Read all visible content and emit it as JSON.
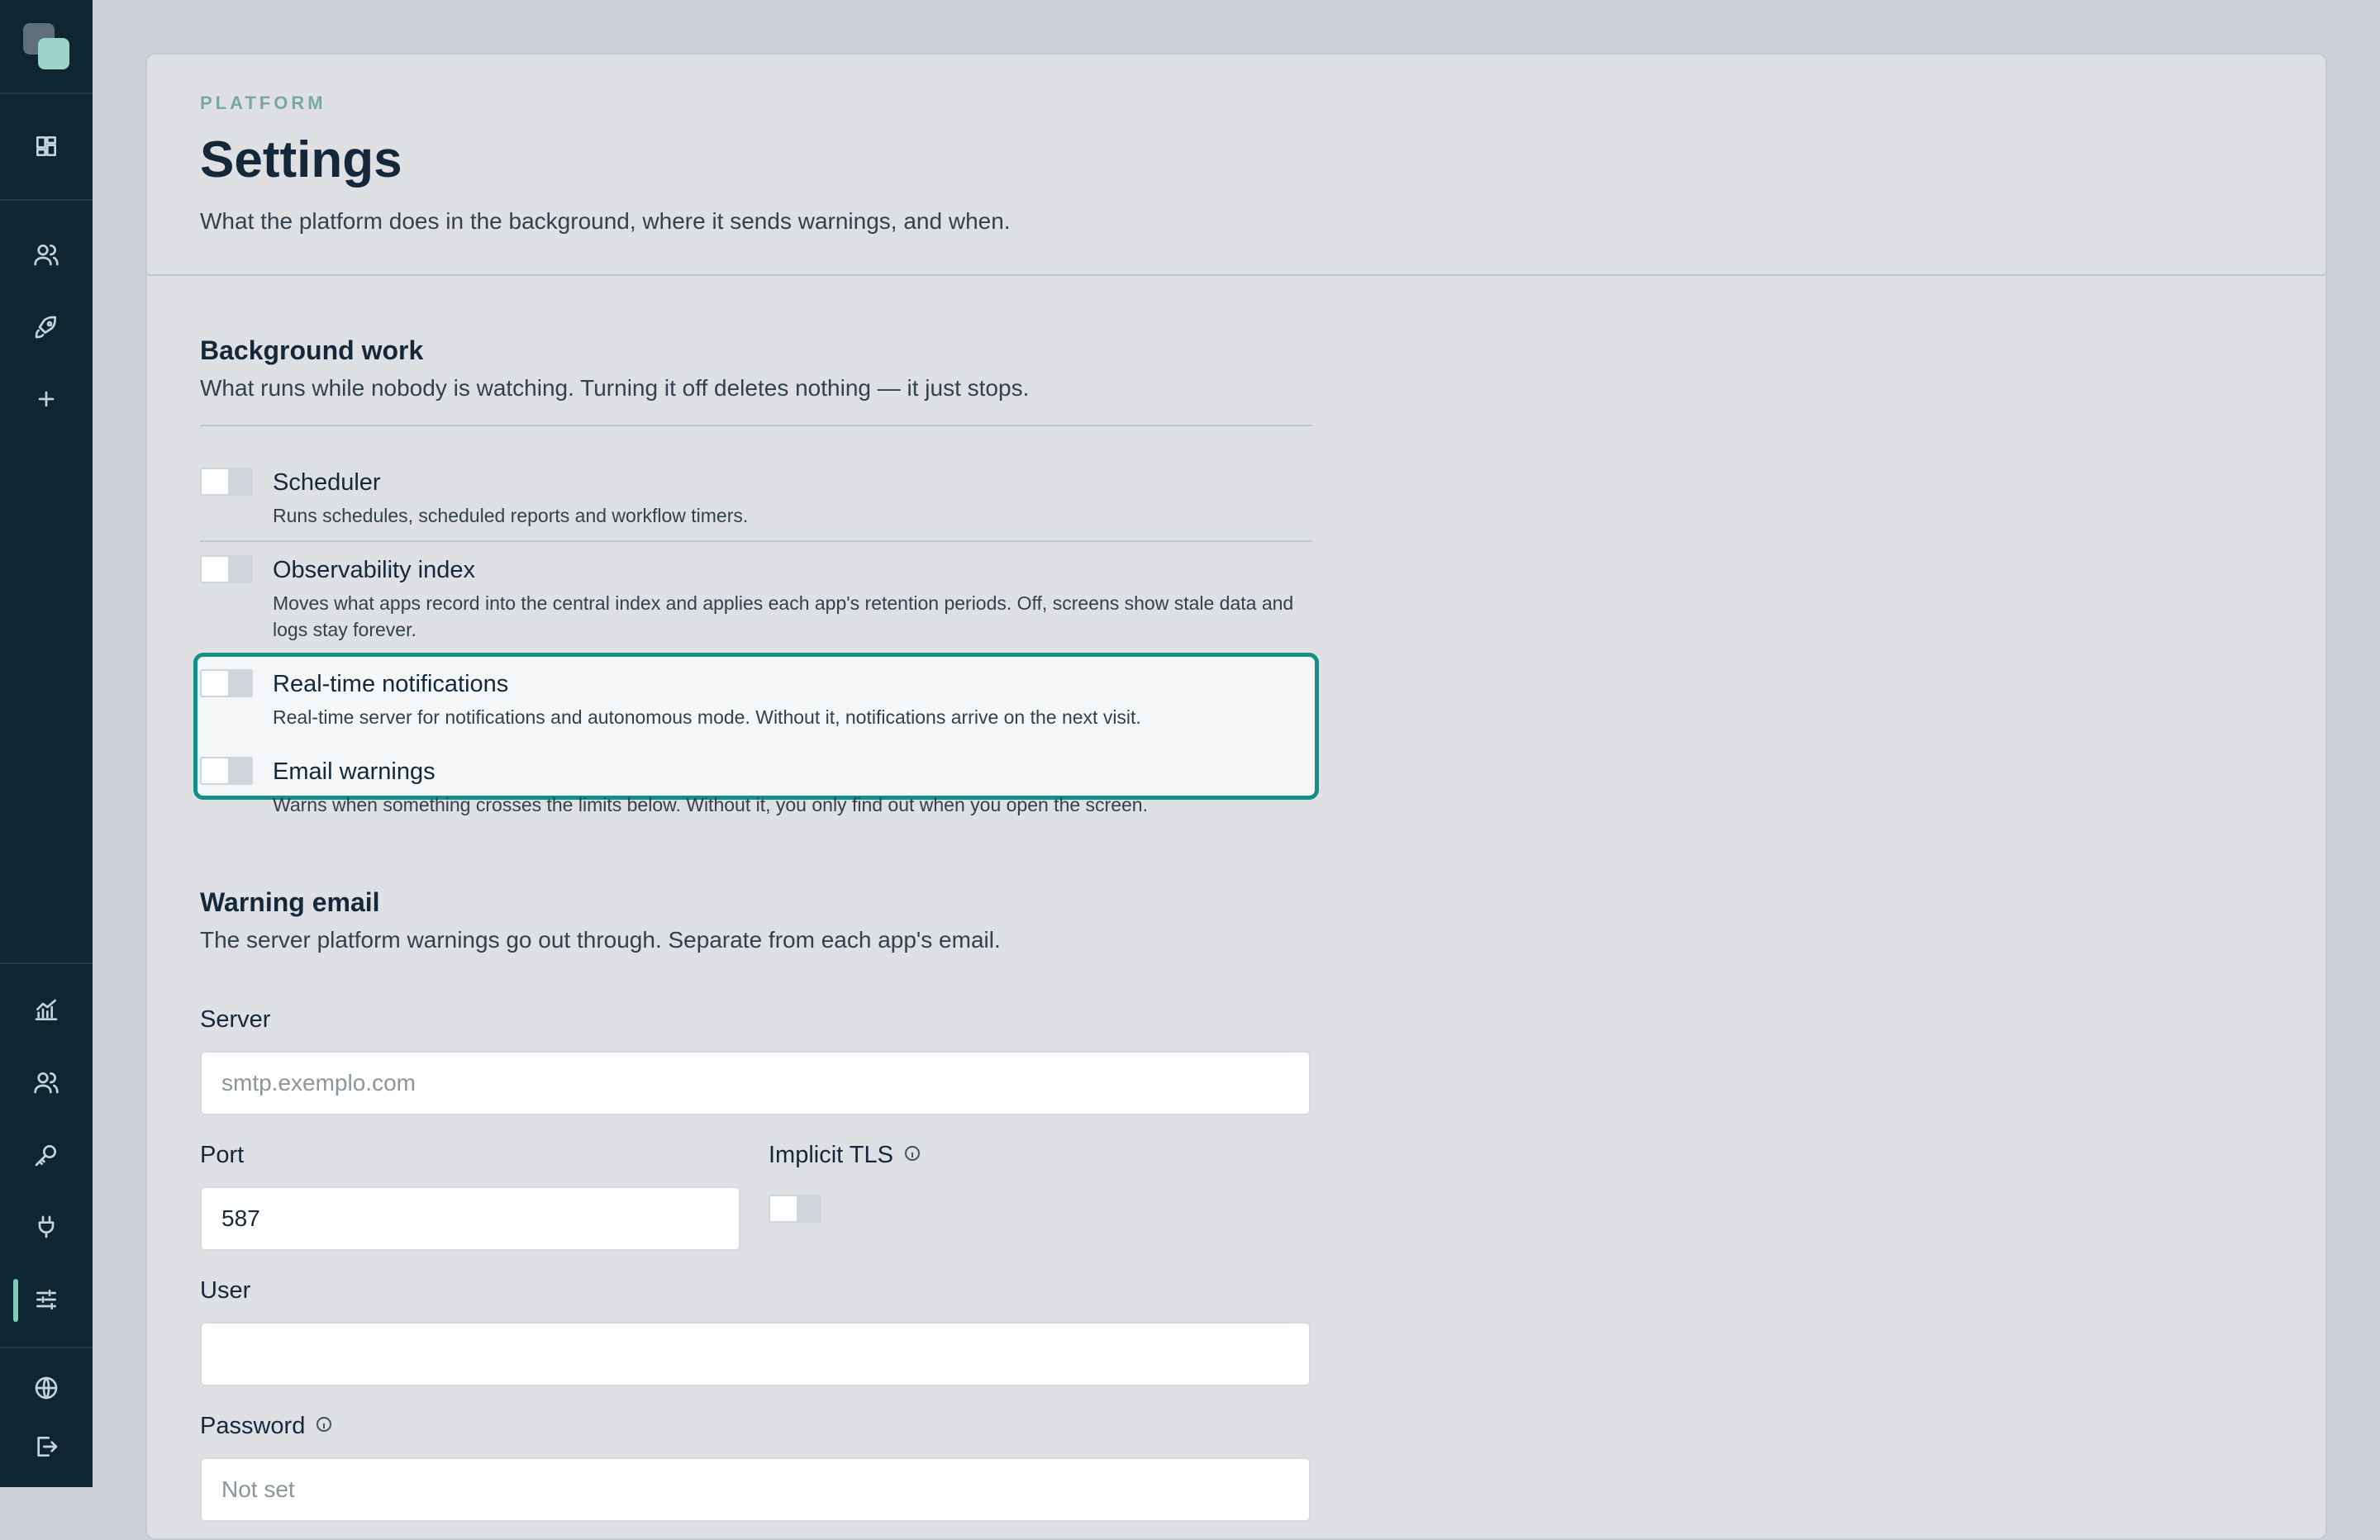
{
  "header": {
    "eyebrow": "PLATFORM",
    "title": "Settings",
    "subtitle": "What the platform does in the background, where it sends warnings, and when."
  },
  "background_work": {
    "title": "Background work",
    "subtitle": "What runs while nobody is watching. Turning it off deletes nothing — it just stops.",
    "items": [
      {
        "title": "Scheduler",
        "desc": "Runs schedules, scheduled reports and workflow timers.",
        "enabled": false
      },
      {
        "title": "Observability index",
        "desc": "Moves what apps record into the central index and applies each app's retention periods. Off, screens show stale data and logs stay forever.",
        "enabled": false
      },
      {
        "title": "Real-time notifications",
        "desc": "Real-time server for notifications and autonomous mode. Without it, notifications arrive on the next visit.",
        "enabled": false
      },
      {
        "title": "Email warnings",
        "desc": "Warns when something crosses the limits below. Without it, you only find out when you open the screen.",
        "enabled": false
      }
    ]
  },
  "warning_email": {
    "title": "Warning email",
    "subtitle": "The server platform warnings go out through. Separate from each app's email.",
    "server_label": "Server",
    "server_placeholder": "smtp.exemplo.com",
    "port_label": "Port",
    "port_value": "587",
    "tls_label": "Implicit TLS",
    "user_label": "User",
    "user_value": "",
    "password_label": "Password",
    "password_placeholder": "Not set"
  },
  "sidebar": {
    "icons": [
      "dashboard-icon",
      "users-icon",
      "rocket-icon",
      "plus-icon",
      "analytics-icon",
      "team-icon",
      "key-icon",
      "plug-icon",
      "settings-sliders-icon",
      "globe-icon",
      "logout-icon"
    ],
    "active": "settings-sliders-icon",
    "accent": "#7ecbbd"
  },
  "colors": {
    "highlight": "#139086",
    "sidebar_bg": "#0e2631"
  }
}
